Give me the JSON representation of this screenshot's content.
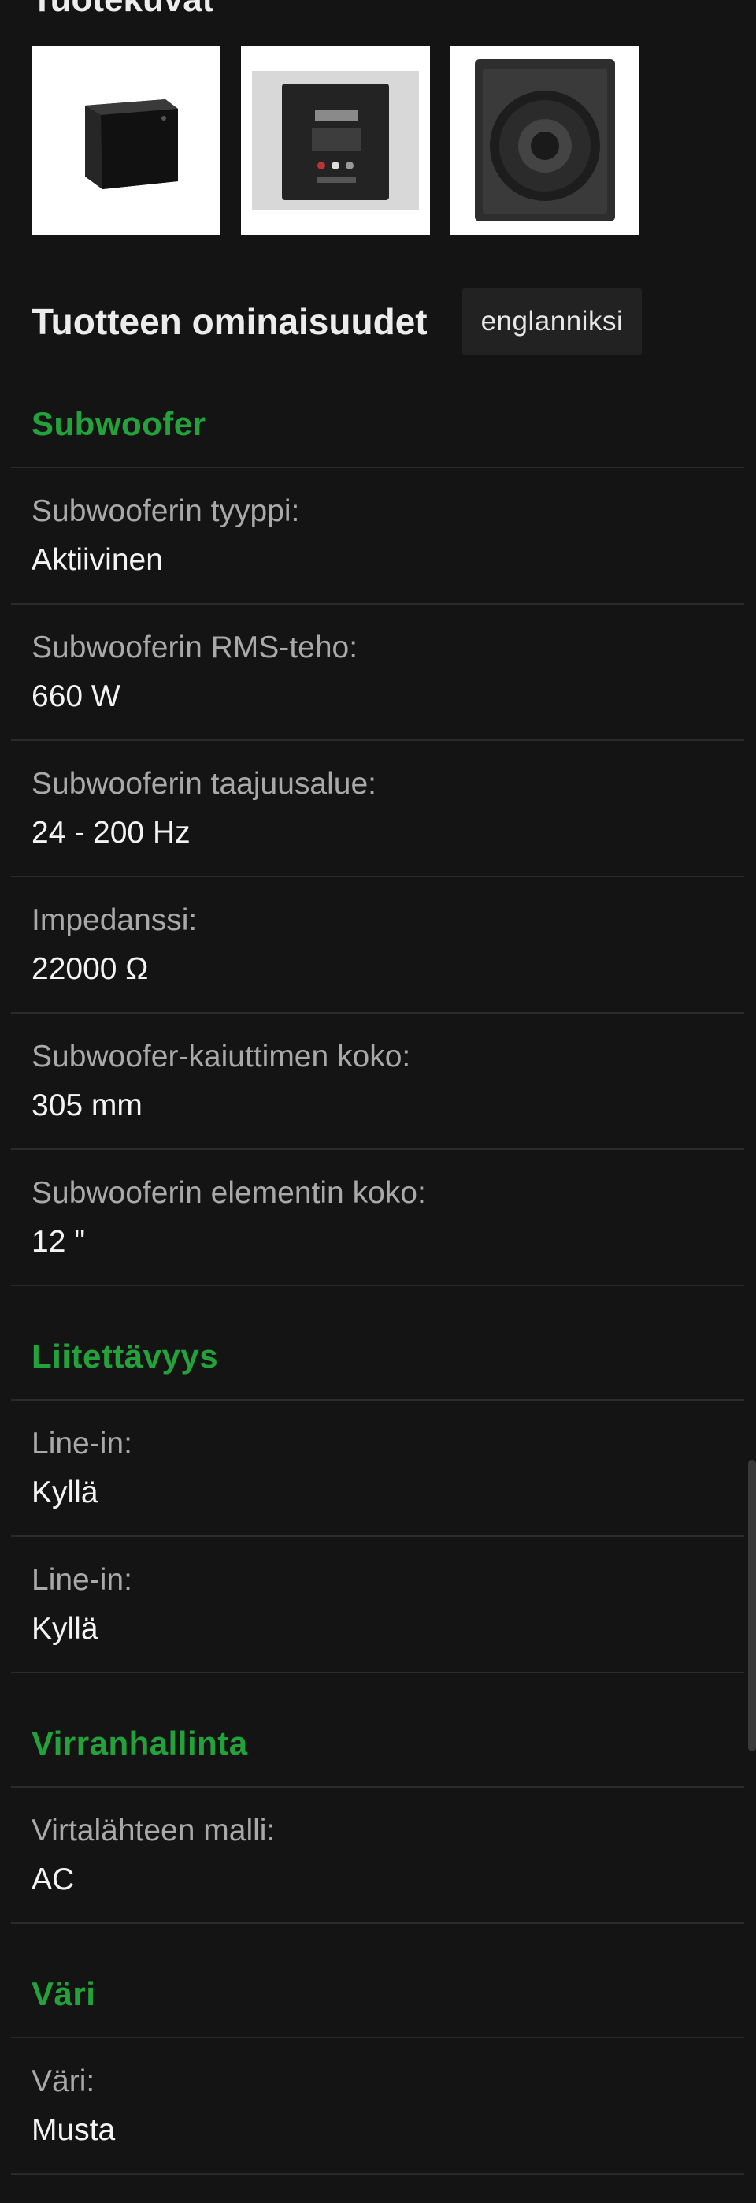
{
  "images": {
    "title": "Tuotekuvat",
    "items": [
      {
        "alt": "front-angle"
      },
      {
        "alt": "rear-panel"
      },
      {
        "alt": "driver-front"
      }
    ]
  },
  "features": {
    "title": "Tuotteen ominaisuudet",
    "lang_button": "englanniksi"
  },
  "sections": [
    {
      "title": "Subwoofer",
      "rows": [
        {
          "label": "Subwooferin tyyppi:",
          "value": "Aktiivinen"
        },
        {
          "label": "Subwooferin RMS-teho:",
          "value": "660 W"
        },
        {
          "label": "Subwooferin taajuusalue:",
          "value": "24 - 200 Hz"
        },
        {
          "label": "Impedanssi:",
          "value": "22000 Ω"
        },
        {
          "label": "Subwoofer-kaiuttimen koko:",
          "value": "305 mm"
        },
        {
          "label": "Subwooferin elementin koko:",
          "value": "12 \""
        }
      ]
    },
    {
      "title": "Liitettävyys",
      "rows": [
        {
          "label": "Line-in:",
          "value": "Kyllä"
        },
        {
          "label": "Line-in:",
          "value": "Kyllä"
        }
      ]
    },
    {
      "title": "Virranhallinta",
      "rows": [
        {
          "label": "Virtalähteen malli:",
          "value": "AC"
        }
      ]
    },
    {
      "title": "Väri",
      "rows": [
        {
          "label": "Väri:",
          "value": "Musta"
        }
      ]
    }
  ],
  "colors": {
    "background": "#141414",
    "accent": "#23a23c",
    "label": "#a9a9a9",
    "value": "#f3f3f3"
  }
}
